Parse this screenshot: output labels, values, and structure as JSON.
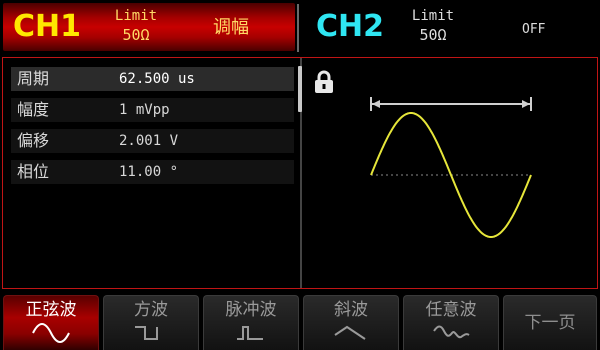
{
  "ch1": {
    "name": "CH1",
    "limit_label": "Limit",
    "impedance": "50Ω",
    "mode": "调幅"
  },
  "ch2": {
    "name": "CH2",
    "limit_label": "Limit",
    "impedance": "50Ω",
    "state": "OFF"
  },
  "params": [
    {
      "name": "周期",
      "value": "62.500 us"
    },
    {
      "name": "幅度",
      "value": "1 mVpp"
    },
    {
      "name": "偏移",
      "value": "2.001 V"
    },
    {
      "name": "相位",
      "value": "11.00 °"
    }
  ],
  "waveform": {
    "type": "sine",
    "locked": true
  },
  "softkeys": [
    {
      "label": "正弦波",
      "icon": "sine-wave-icon",
      "active": true
    },
    {
      "label": "方波",
      "icon": "square-wave-icon",
      "active": false
    },
    {
      "label": "脉冲波",
      "icon": "pulse-wave-icon",
      "active": false
    },
    {
      "label": "斜波",
      "icon": "ramp-wave-icon",
      "active": false
    },
    {
      "label": "任意波",
      "icon": "arbitrary-wave-icon",
      "active": false
    },
    {
      "label": "下一页",
      "icon": "",
      "active": false
    }
  ],
  "colors": {
    "ch1_yellow": "#ffe800",
    "ch2_cyan": "#2fe6f2",
    "wave": "#e6e63a",
    "accent_red": "#c01515"
  }
}
